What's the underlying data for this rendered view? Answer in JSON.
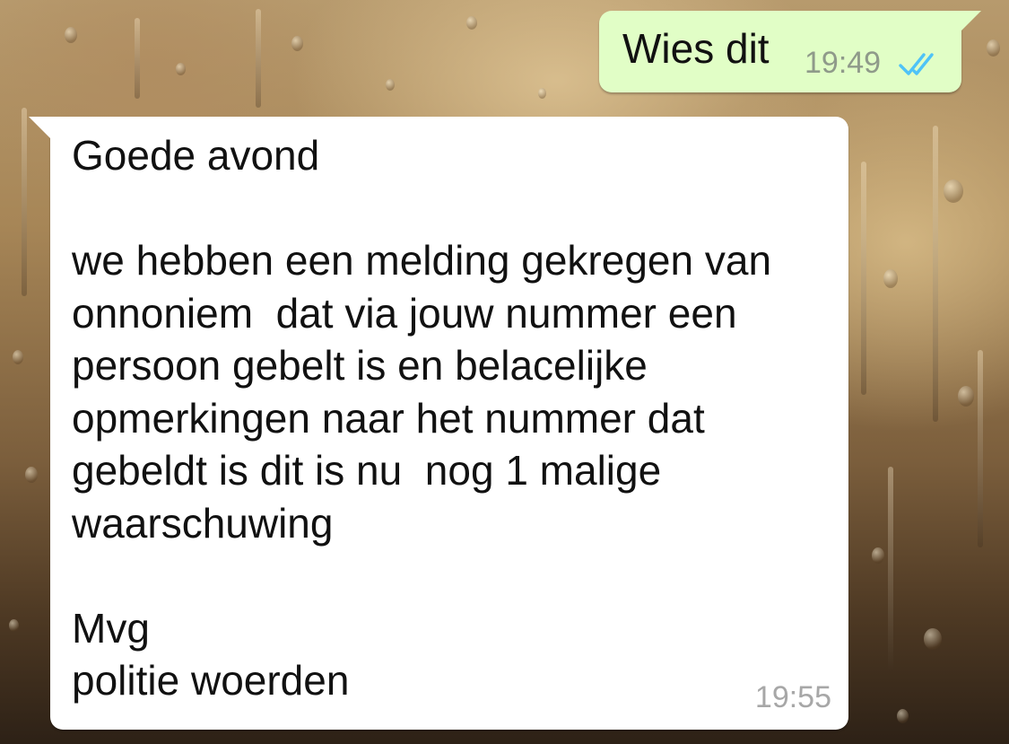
{
  "conversation": {
    "outgoing_message": {
      "text": "Wies dit",
      "time": "19:49",
      "status": "read",
      "status_icon": "double-check-icon",
      "status_color": "#4fc3f7",
      "bubble_color": "#e1fec6"
    },
    "incoming_message": {
      "text": "Goede avond\n\nwe hebben een melding gekregen van\nonnoniem  dat via jouw nummer een\npersoon gebelt is en belacelijke\nopmerkingen naar het nummer dat\ngebeldt is dit is nu  nog 1 malige\nwaarschuwing\n\nMvg\npolitie woerden",
      "time": "19:55",
      "bubble_color": "#ffffff"
    }
  }
}
